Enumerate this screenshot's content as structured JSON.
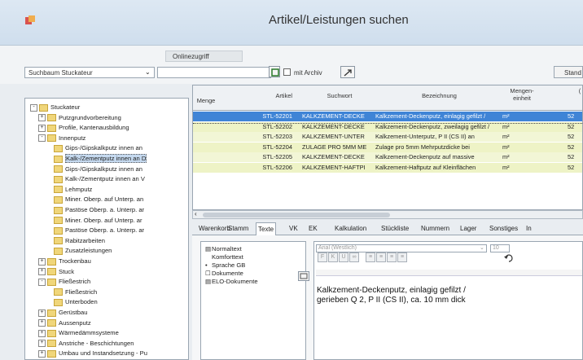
{
  "window": {
    "title": "Artikel/Leistungen suchen"
  },
  "toolbar": {
    "onlinezugriff_label": "Onlinezugriff",
    "suchbaum_value": "Suchbaum Stuckateur",
    "search_value": "",
    "archiv_label": "mit Archiv",
    "standard_label": "Stand"
  },
  "tree": [
    {
      "exp": "-",
      "label": "Stuckateur",
      "indent": 0
    },
    {
      "exp": "+",
      "label": "Putzgrundvorbereitung",
      "indent": 1
    },
    {
      "exp": "+",
      "label": "Profile, Kantenausbildung",
      "indent": 1
    },
    {
      "exp": "-",
      "label": "Innenputz",
      "indent": 1
    },
    {
      "exp": "",
      "label": "Gips-/Gipskalkputz innen an",
      "indent": 2
    },
    {
      "exp": "",
      "label": "Kalk-/Zementputz innen an D",
      "indent": 2,
      "sel": true
    },
    {
      "exp": "",
      "label": "Gips-/Gipskalkputz innen an",
      "indent": 2
    },
    {
      "exp": "",
      "label": "Kalk-/Zementputz innen an V",
      "indent": 2
    },
    {
      "exp": "",
      "label": "Lehmputz",
      "indent": 2
    },
    {
      "exp": "",
      "label": "Miner. Oberp. auf Unterp. an",
      "indent": 2
    },
    {
      "exp": "",
      "label": "Pastöse Oberp. a. Unterp. ar",
      "indent": 2
    },
    {
      "exp": "",
      "label": "Miner. Oberp. auf Unterp. ar",
      "indent": 2
    },
    {
      "exp": "",
      "label": "Pastöse Oberp. a. Unterp. ar",
      "indent": 2
    },
    {
      "exp": "",
      "label": "Rabitzarbeiten",
      "indent": 2
    },
    {
      "exp": "",
      "label": "Zusatzleistungen",
      "indent": 2
    },
    {
      "exp": "+",
      "label": "Trockenbau",
      "indent": 1
    },
    {
      "exp": "+",
      "label": "Stuck",
      "indent": 1
    },
    {
      "exp": "-",
      "label": "Fließestrich",
      "indent": 1
    },
    {
      "exp": "",
      "label": "Fließestrich",
      "indent": 2
    },
    {
      "exp": "",
      "label": "Unterboden",
      "indent": 2
    },
    {
      "exp": "+",
      "label": "Gerüstbau",
      "indent": 1
    },
    {
      "exp": "+",
      "label": "Aussenputz",
      "indent": 1
    },
    {
      "exp": "+",
      "label": "Wärmedämmsysteme",
      "indent": 1
    },
    {
      "exp": "+",
      "label": "Anstriche - Beschichtungen",
      "indent": 1
    },
    {
      "exp": "+",
      "label": "Umbau und Instandsetzung - Pu",
      "indent": 1
    }
  ],
  "grid": {
    "headers": {
      "menge": "Menge",
      "artikel": "Artikel",
      "suchwort": "Suchwort",
      "bezeichnung": "Bezeichnung",
      "einheit1": "Mengen-",
      "einheit2": "einheit",
      "extra": "("
    },
    "rows": [
      {
        "artikel": "STL-52201",
        "suchwort": "KALKZEMENT-DECKE",
        "bez": "Kalkzement-Deckenputz, einlagig gefilzt /",
        "einheit": "m²",
        "val": "52"
      },
      {
        "artikel": "STL-52202",
        "suchwort": "KALKZEMENT-DECKE",
        "bez": "Kalkzement-Deckenputz, zweilagig gefilzt /",
        "einheit": "m²",
        "val": "52"
      },
      {
        "artikel": "STL-52203",
        "suchwort": "KALKZEMENT-UNTER",
        "bez": "Kalkzement-Unterputz, P II (CS II) an",
        "einheit": "m²",
        "val": "52"
      },
      {
        "artikel": "STL-52204",
        "suchwort": "ZULAGE PRO 5MM ME",
        "bez": "Zulage pro 5mm Mehrputzdicke bei",
        "einheit": "m²",
        "val": "52"
      },
      {
        "artikel": "STL-52205",
        "suchwort": "KALKZEMENT-DECKE",
        "bez": "Kalkzement-Deckenputz auf massive",
        "einheit": "m²",
        "val": "52"
      },
      {
        "artikel": "STL-52206",
        "suchwort": "KALKZEMENT-HAFTPI",
        "bez": "Kalkzement-Haftputz auf Kleinflächen",
        "einheit": "m²",
        "val": "52"
      }
    ]
  },
  "tabs": [
    "Warenkorb",
    "Stamm",
    "Texte",
    "VK",
    "EK",
    "Kalkulation",
    "Stückliste",
    "Nummern",
    "Lager",
    "Sonstiges",
    "In"
  ],
  "active_tab": "Texte",
  "textlist": [
    "Normaltext",
    "Komforttext",
    "Sprache GB",
    "Dokumente",
    "ELO-Dokumente"
  ],
  "editor": {
    "font": "Arial (Westlich)",
    "size": "10",
    "text": "Kalkzement-Deckenputz, einlagig gefilzt /\ngerieben Q 2, P II (CS II), ca. 10 mm dick"
  },
  "colors": {
    "selected_row": "#3f84d6",
    "row_bg": "#eef3c6",
    "accent": "#c43a2f"
  }
}
